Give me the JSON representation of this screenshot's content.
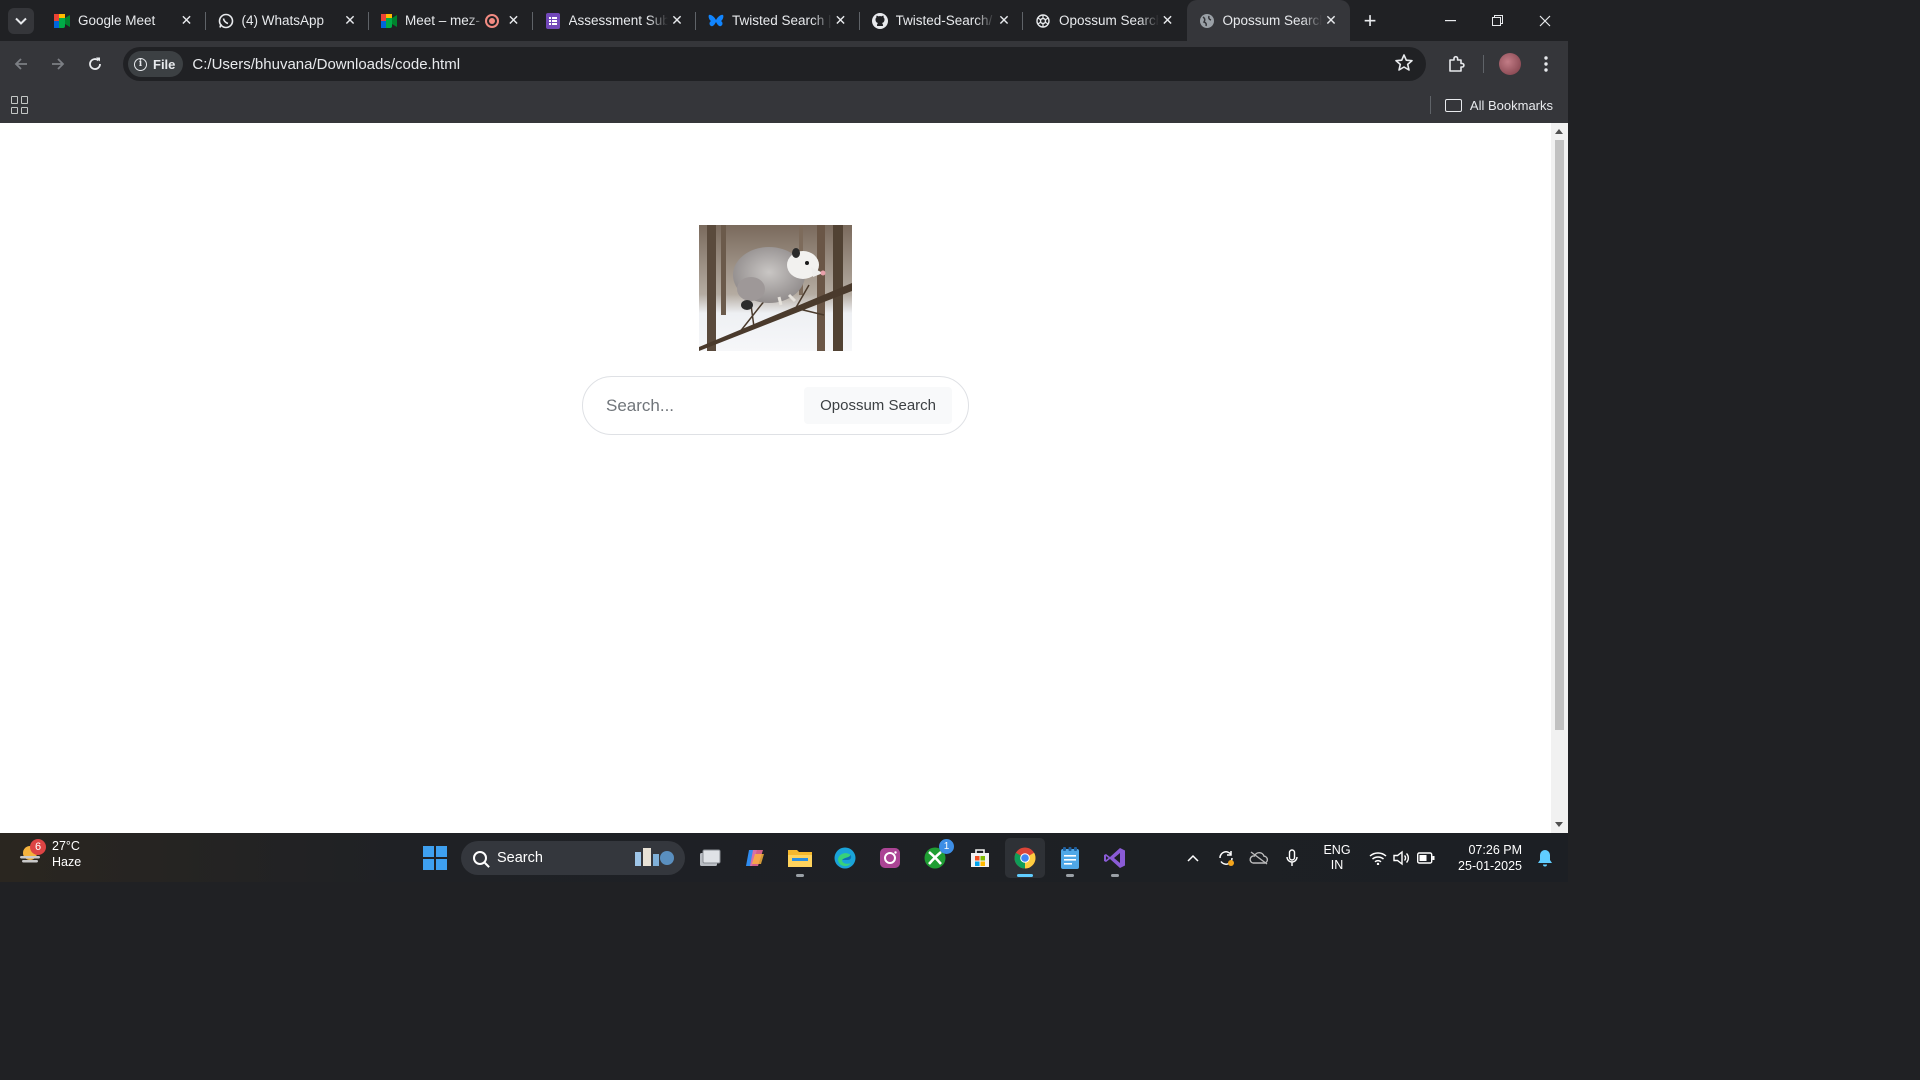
{
  "browser": {
    "tabs": [
      {
        "title": "Google Meet",
        "icon": "google-meet-icon",
        "active": false
      },
      {
        "title": "(4) WhatsApp",
        "icon": "whatsapp-icon",
        "active": false
      },
      {
        "title": "Meet – mez-",
        "icon": "google-meet-icon",
        "active": false,
        "recording": true
      },
      {
        "title": "Assessment Sub",
        "icon": "google-forms-icon",
        "active": false
      },
      {
        "title": "Twisted Search |",
        "icon": "bluesky-butterfly-icon",
        "active": false
      },
      {
        "title": "Twisted-Search/",
        "icon": "github-icon",
        "active": false
      },
      {
        "title": "Opossum Search",
        "icon": "openai-icon",
        "active": false
      },
      {
        "title": "Opossum Search",
        "icon": "globe-icon",
        "active": true
      }
    ],
    "address": {
      "chip_label": "File",
      "url": "C:/Users/bhuvana/Downloads/code.html"
    },
    "bookmarks": {
      "all_bookmarks_label": "All Bookmarks"
    }
  },
  "page": {
    "logo_alt": "Opossum",
    "search_placeholder": "Search...",
    "search_button": "Opossum Search"
  },
  "taskbar": {
    "weather": {
      "temp": "27°C",
      "condition": "Haze",
      "badge": "6"
    },
    "search_label": "Search",
    "xbox_badge": "1",
    "language": {
      "line1": "ENG",
      "line2": "IN"
    },
    "clock": {
      "time": "07:26 PM",
      "date": "25-01-2025"
    }
  },
  "colors": {
    "chrome_dark": "#202124",
    "chrome_toolbar": "#35363a",
    "page_bg": "#ffffff",
    "accent_blue": "#60cdff"
  }
}
